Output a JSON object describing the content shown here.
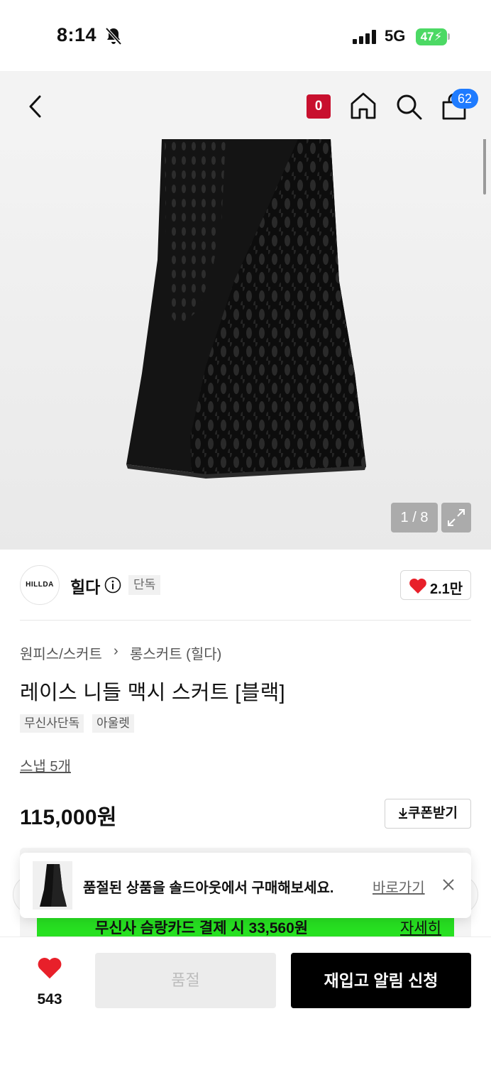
{
  "status_bar": {
    "time": "8:14",
    "network": "5G",
    "battery": "47",
    "icons": [
      "bell-slash-icon",
      "signal-icon",
      "battery-icon"
    ]
  },
  "header": {
    "badge_label": "0",
    "cart_count": "62",
    "icons": [
      "back-icon",
      "home-icon",
      "search-icon",
      "cart-icon"
    ],
    "badge_color": "#c8102e",
    "cart_badge_color": "#1e7bff"
  },
  "gallery": {
    "page_indicator": "1 / 8",
    "icons": [
      "expand-icon"
    ]
  },
  "brand": {
    "logo_text": "HILLDA",
    "name": "힐다",
    "tag": "단독",
    "like_count": "2.1만",
    "icons": [
      "info-icon",
      "heart-icon"
    ],
    "heart_color": "#e8202a"
  },
  "product": {
    "breadcrumb": [
      "원피스/스커트",
      "롱스커트 (힐다)"
    ],
    "breadcrumb_sep": "›",
    "title": "레이스 니들 맥시 스커트 [블랙]",
    "tags": [
      "무신사단독",
      "아울렛"
    ],
    "snap_link": "스냅 5개",
    "price": "115,000원",
    "coupon_label": "쿠폰받기",
    "icons": [
      "download-icon"
    ]
  },
  "benefit": {
    "strip_text": "무신사 슴랑카드 결제 시 33,560원",
    "strip_link": "자세히",
    "strip_color": "#27e021"
  },
  "toast": {
    "message": "품절된 상품을 솔드아웃에서 구매해보세요.",
    "link": "바로가기",
    "icons": [
      "close-icon"
    ]
  },
  "bottom_bar": {
    "wish_count": "543",
    "soldout_label": "품절",
    "restock_label": "재입고 알림 신청",
    "icons": [
      "heart-icon"
    ]
  }
}
